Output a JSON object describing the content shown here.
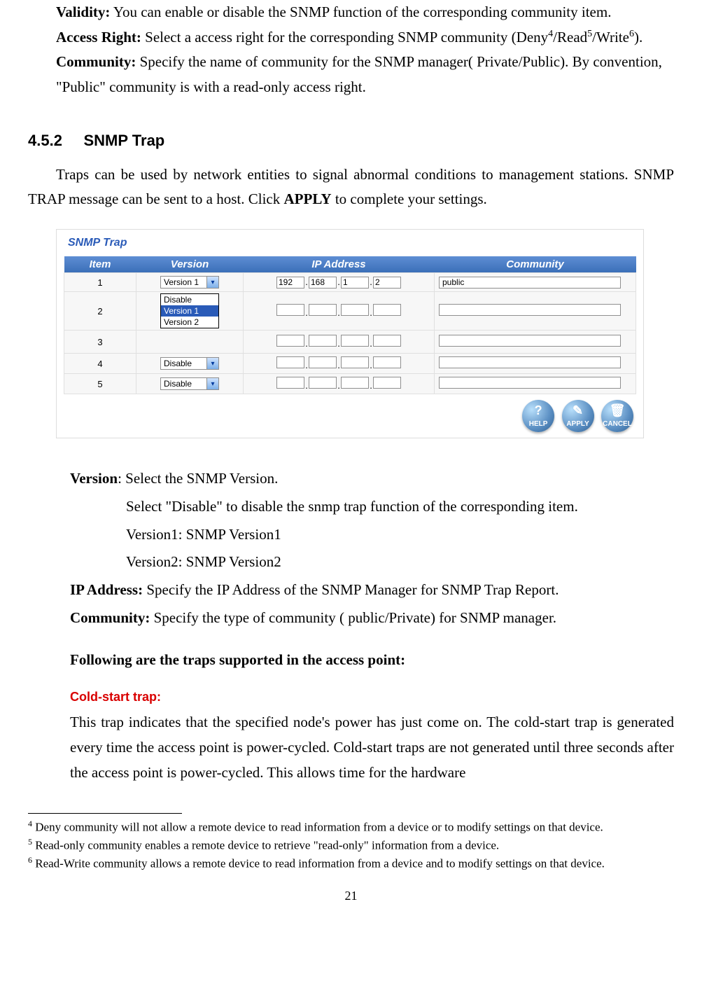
{
  "top": {
    "validity_label": "Validity:",
    "validity_text": " You can enable or disable the SNMP function of the corresponding community item.",
    "access_label": "Access Right:",
    "access_text_1": " Select a access right for the corresponding SNMP community (Deny",
    "access_sup_4": "4",
    "access_text_2": "/Read",
    "access_sup_5": "5",
    "access_text_3": "/Write",
    "access_sup_6": "6",
    "access_text_4": ").",
    "community_label": "Community:",
    "community_text": " Specify the name of community for the SNMP manager( Private/Public). By convention, \"Public\" community is with a read-only access right."
  },
  "section": {
    "num": "4.5.2",
    "title": "SNMP Trap",
    "para_pre": "Traps can be used by network entities to signal abnormal conditions to management stations. SNMP TRAP message can be sent to a host. Click ",
    "para_bold": "APPLY",
    "para_post": " to complete your settings."
  },
  "panel": {
    "title": "SNMP Trap",
    "columns": [
      "Item",
      "Version",
      "IP Address",
      "Community"
    ],
    "dropdown_options": [
      "Disable",
      "Version 1",
      "Version 2"
    ],
    "rows": [
      {
        "item": "1",
        "version": "Version 1",
        "open": true,
        "selected": "Version 1",
        "ip": [
          "192",
          "168",
          "1",
          "2"
        ],
        "community": "public"
      },
      {
        "item": "2",
        "version": "",
        "ip": [
          "",
          "",
          "",
          ""
        ],
        "community": ""
      },
      {
        "item": "3",
        "version": "",
        "ip": [
          "",
          "",
          "",
          ""
        ],
        "community": ""
      },
      {
        "item": "4",
        "version": "Disable",
        "ip": [
          "",
          "",
          "",
          ""
        ],
        "community": ""
      },
      {
        "item": "5",
        "version": "Disable",
        "ip": [
          "",
          "",
          "",
          ""
        ],
        "community": ""
      }
    ],
    "buttons": {
      "help": "HELP",
      "apply": "APPLY",
      "cancel": "CANCEL"
    }
  },
  "desc": {
    "version_label": "Version",
    "version_text": ": Select the SNMP Version.",
    "version_sub1": "Select \"Disable\" to disable the snmp trap function of the corresponding item.",
    "version_sub2": "Version1: SNMP Version1",
    "version_sub3": "Version2: SNMP Version2",
    "ip_label": "IP Address:",
    "ip_text": " Specify the IP Address of the SNMP Manager for SNMP Trap Report.",
    "community_label": "Community:",
    "community_text": " Specify the type of community ( public/Private) for SNMP manager.",
    "supported_heading": "Following are the traps supported in the access point:",
    "cold_heading": "Cold-start trap:",
    "cold_text": "This trap indicates that the specified node's power has just come on. The cold-start trap is generated every time the access point is power-cycled. Cold-start traps are not generated until three seconds after the access point is power-cycled. This allows time for the hardware"
  },
  "footnotes": {
    "f4_sup": "4",
    "f4": " Deny community will not allow a remote device to read information from a device or to modify settings on that device.",
    "f5_sup": "5",
    "f5": " Read-only community enables a remote device to retrieve \"read-only\" information from a device.",
    "f6_sup": "6",
    "f6": " Read-Write community allows a remote device to read information from a device and to modify settings on that device."
  },
  "pagenum": "21"
}
